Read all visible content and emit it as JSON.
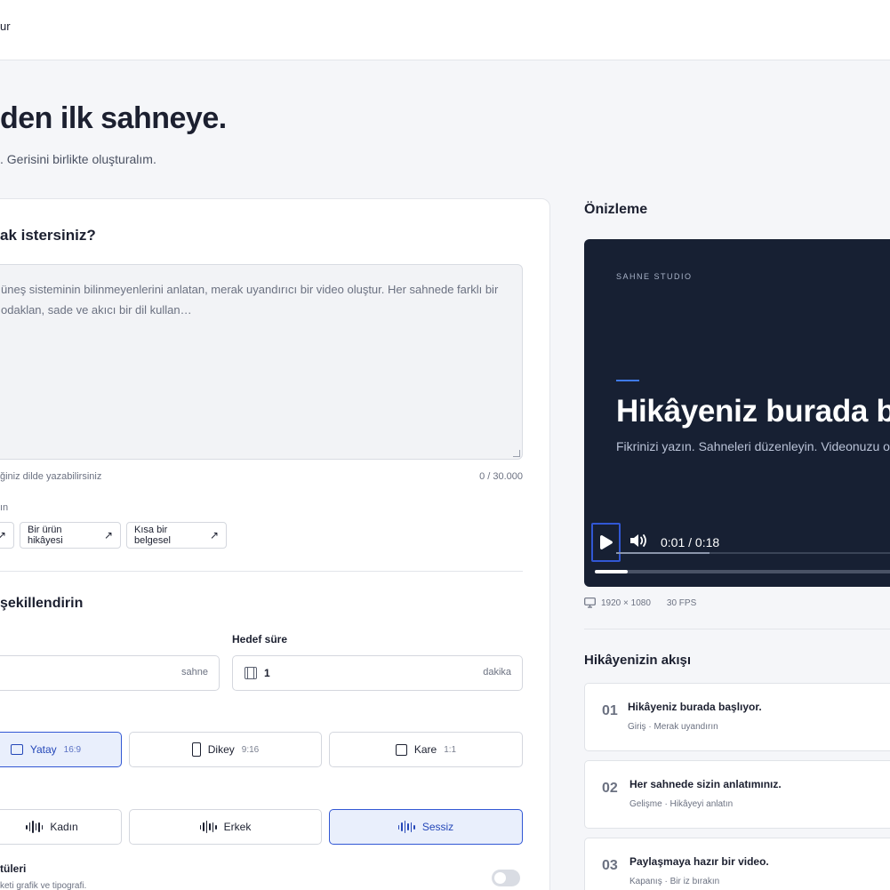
{
  "topbar": {
    "text": "ur"
  },
  "hero": {
    "title": "den ilk sahneye.",
    "subtitle": ". Gerisini birlikte oluşturalım."
  },
  "form": {
    "question": "ak istersiniz?",
    "prompt_placeholder": "üneş sisteminin bilinmeyenlerini anlatan, merak uyandırıcı bir video oluştur. Her sahnede farklı bir odaklan, sade ve akıcı bir dil kullan…",
    "hint": "ğiniz dilde yazabilirsiniz",
    "char_count": "0 / 30.000",
    "examples_label": "ın",
    "examples": [
      {
        "label": ""
      },
      {
        "label": "Bir ürün hikâyesi"
      },
      {
        "label": "Kısa bir belgesel"
      }
    ],
    "shape_title": "şekillendirin",
    "scene_unit": "sahne",
    "target_label": "Hedef süre",
    "duration_value": "1",
    "duration_unit": "dakika",
    "orientations": [
      {
        "label": "Yatay",
        "ratio": "16:9",
        "selected": true
      },
      {
        "label": "Dikey",
        "ratio": "9:16",
        "selected": false
      },
      {
        "label": "Kare",
        "ratio": "1:1",
        "selected": false
      }
    ],
    "voices": [
      {
        "label": "Kadın",
        "selected": false
      },
      {
        "label": "Erkek",
        "selected": false
      },
      {
        "label": "Sessiz",
        "selected": true
      }
    ],
    "subtitles_title": "tüleri",
    "subtitles_desc": "keti grafik ve tipografi.",
    "subtitles_enabled": false
  },
  "preview": {
    "heading": "Önizleme",
    "brand": "SAHNE STUDIO",
    "video_title": "Hikâyeniz burada ba",
    "video_subtitle": "Fikrinizi yazın. Sahneleri düzenleyin. Videonuzu olu",
    "time": "0:01 / 0:18",
    "progress_fraction": 0.06,
    "resolution": "1920 × 1080",
    "fps": "30 FPS",
    "accent_color": "#3f7ae8",
    "background_color": "#172033"
  },
  "flow": {
    "heading": "Hikâyenizin akışı",
    "items": [
      {
        "num": "01",
        "title": "Hikâyeniz burada başlıyor.",
        "desc": "Giriş · Merak uyandırın"
      },
      {
        "num": "02",
        "title": "Her sahnede sizin anlatımınız.",
        "desc": "Gelişme · Hikâyeyi anlatın"
      },
      {
        "num": "03",
        "title": "Paylaşmaya hazır bir video.",
        "desc": "Kapanış · Bir iz bırakın"
      }
    ]
  }
}
